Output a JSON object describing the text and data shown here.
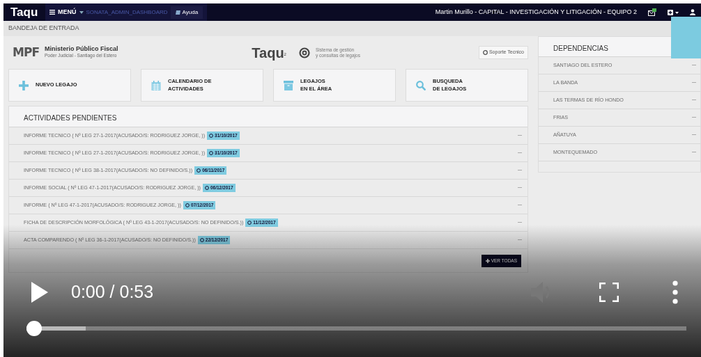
{
  "navbar": {
    "brand": "Taqu",
    "menu": "MENÚ",
    "route": "SONATA_ADMIN_DASHBOARD",
    "help": "Ayuda",
    "user": "Martin Murillo - CAPITAL - INVESTIGACIÓN Y LITIGACIÓN - EQUIPO 2"
  },
  "breadcrumb": "BANDEJA DE ENTRADA",
  "header": {
    "logo": "MPF",
    "org_name": "Ministerio Público Fiscal",
    "org_sub": "Poder Judicial - Santiago del Estero",
    "product": "Taqu",
    "product_sup": "2",
    "tagline_lines": [
      "Sistema de gestión",
      "y consultas de legajos"
    ],
    "support": "Soporte Tecnico"
  },
  "tiles": [
    {
      "kind": "plus",
      "lines": [
        "NUEVO LEGAJO"
      ]
    },
    {
      "kind": "calendar",
      "lines": [
        "CALENDARIO DE",
        "ACTIVIDADES"
      ]
    },
    {
      "kind": "archive",
      "lines": [
        "LEGAJOS",
        "EN EL ÁREA"
      ]
    },
    {
      "kind": "search",
      "lines": [
        "BUSQUEDA",
        "DE LEGAJOS"
      ]
    }
  ],
  "pending": {
    "title": "ACTIVIDADES PENDIENTES",
    "items": [
      {
        "text": "INFORME TECNICO ( Nº LEG 27-1-2017(ACUSADO/S: RODRIGUEZ JORGE, ))",
        "date": "31/10/2017"
      },
      {
        "text": "INFORME TECNICO ( Nº LEG 27-1-2017(ACUSADO/S: RODRIGUEZ JORGE, ))",
        "date": "31/10/2017"
      },
      {
        "text": "INFORME TECNICO ( Nº LEG 38-1-2017(ACUSADO/S: NO DEFINIDO/S.))",
        "date": "06/11/2017"
      },
      {
        "text": "INFORME SOCIAL ( Nº LEG 47-1-2017(ACUSADO/S: RODRIGUEZ JORGE, ))",
        "date": "06/12/2017"
      },
      {
        "text": "INFORME ( Nº LEG 47-1-2017(ACUSADO/S: RODRIGUEZ JORGE, ))",
        "date": "07/12/2017"
      },
      {
        "text": "FICHA DE DESCRIPCIÓN MORFOLÓGICA ( Nº LEG 43-1-2017(ACUSADO/S: NO DEFINIDO/S.))",
        "date": "11/12/2017"
      },
      {
        "text": "ACTA COMPARENDO ( Nº LEG 36-1-2017(ACUSADO/S: NO DEFINIDO/S.))",
        "date": "22/12/2017"
      }
    ],
    "more": "VER TODAS"
  },
  "dependencias": {
    "title": "DEPENDENCIAS",
    "items": [
      "SANTIAGO DEL ESTERO",
      "LA BANDA",
      "LAS TERMAS DE RÍO HONDO",
      "FRIAS",
      "AÑATUYA",
      "MONTEQUEMADO"
    ]
  },
  "player": {
    "time": "0:00 / 0:53",
    "progress": {
      "level": 0,
      "buffer": {
        "level": 0.09
      }
    }
  }
}
